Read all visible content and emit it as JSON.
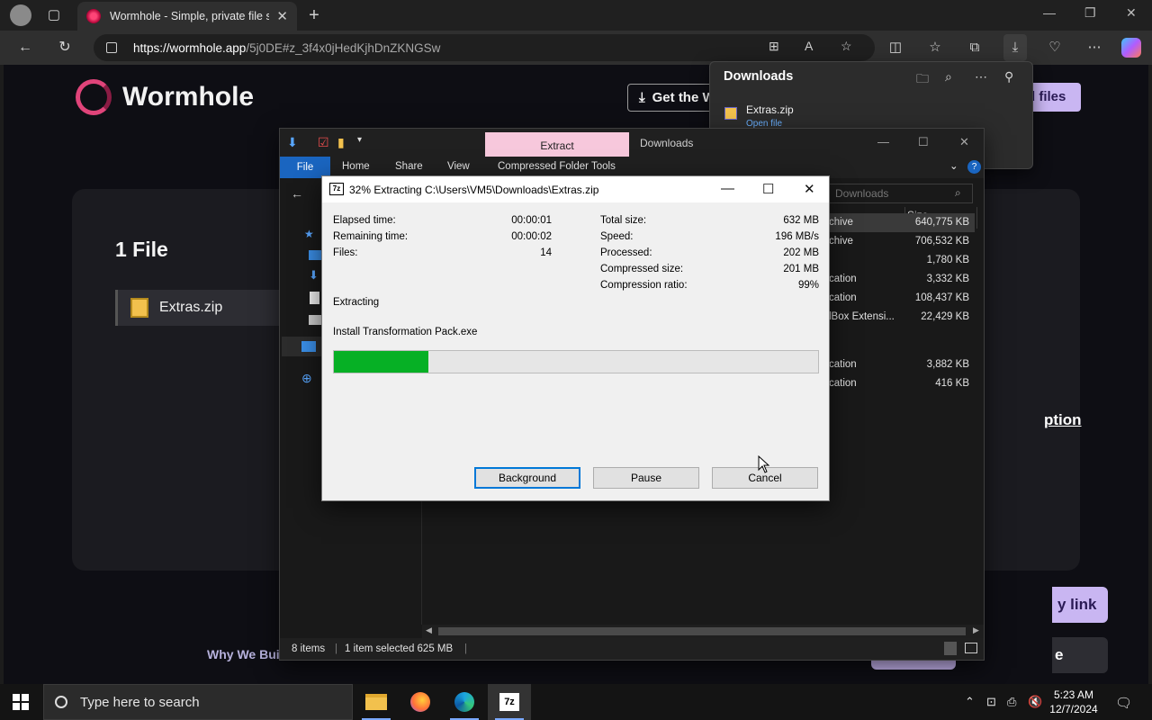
{
  "browser": {
    "tab_title": "Wormhole - Simple, private file sh",
    "url_host": "https://wormhole.app",
    "url_path": "/5j0DE#z_3f4x0jHedKjhDnZKNGSw"
  },
  "site": {
    "brand": "Wormhole",
    "get_button": "Get the W",
    "send_button": "d files",
    "files_heading": "1 File",
    "file_name": "Extras.zip",
    "option_link": "ption",
    "copy_button": "y link",
    "dark_button": "e",
    "footer_link": "Why We Buil"
  },
  "downloads": {
    "title": "Downloads",
    "item_name": "Extras.zip",
    "item_action": "Open file"
  },
  "explorer": {
    "extract_tab": "Extract",
    "folder_name": "Downloads",
    "ribbon": [
      "File",
      "Home",
      "Share",
      "View",
      "Compressed Folder Tools"
    ],
    "search_placeholder": "Downloads",
    "size_header": "Size",
    "rows": [
      {
        "type": "chive",
        "size": "640,775 KB"
      },
      {
        "type": "chive",
        "size": "706,532 KB"
      },
      {
        "type": "",
        "size": "1,780 KB"
      },
      {
        "type": "cation",
        "size": "3,332 KB"
      },
      {
        "type": "cation",
        "size": "108,437 KB"
      },
      {
        "type": "lBox Extensi...",
        "size": "22,429 KB"
      },
      {
        "type": "cation",
        "size": "3,882 KB"
      },
      {
        "type": "cation",
        "size": "416 KB"
      }
    ],
    "status_items": "8 items",
    "status_selected": "1 item selected  625 MB"
  },
  "zip_dialog": {
    "app_icon": "7z",
    "title": "32% Extracting C:\\Users\\VM5\\Downloads\\Extras.zip",
    "progress": 0.195,
    "left_stats": [
      {
        "label": "Elapsed time:",
        "value": "00:00:01"
      },
      {
        "label": "Remaining time:",
        "value": "00:00:02"
      },
      {
        "label": "Files:",
        "value": "14"
      }
    ],
    "right_stats": [
      {
        "label": "Total size:",
        "value": "632 MB"
      },
      {
        "label": "Speed:",
        "value": "196 MB/s"
      },
      {
        "label": "Processed:",
        "value": "202 MB"
      },
      {
        "label": "Compressed size:",
        "value": "201 MB"
      },
      {
        "label": "Compression ratio:",
        "value": "99%"
      }
    ],
    "status": "Extracting",
    "current_file": "Install Transformation Pack.exe",
    "buttons": {
      "background": "Background",
      "pause": "Pause",
      "cancel": "Cancel"
    }
  },
  "taskbar": {
    "search_placeholder": "Type here to search",
    "pinned_7zip": "7z",
    "time": "5:23 AM",
    "date": "12/7/2024"
  },
  "colors": {
    "progress_fill": "#06b025",
    "accent_purple": "#c9b6f2",
    "explorer_file_tab": "#1a65c0",
    "extract_tab": "#f7c8dc"
  }
}
